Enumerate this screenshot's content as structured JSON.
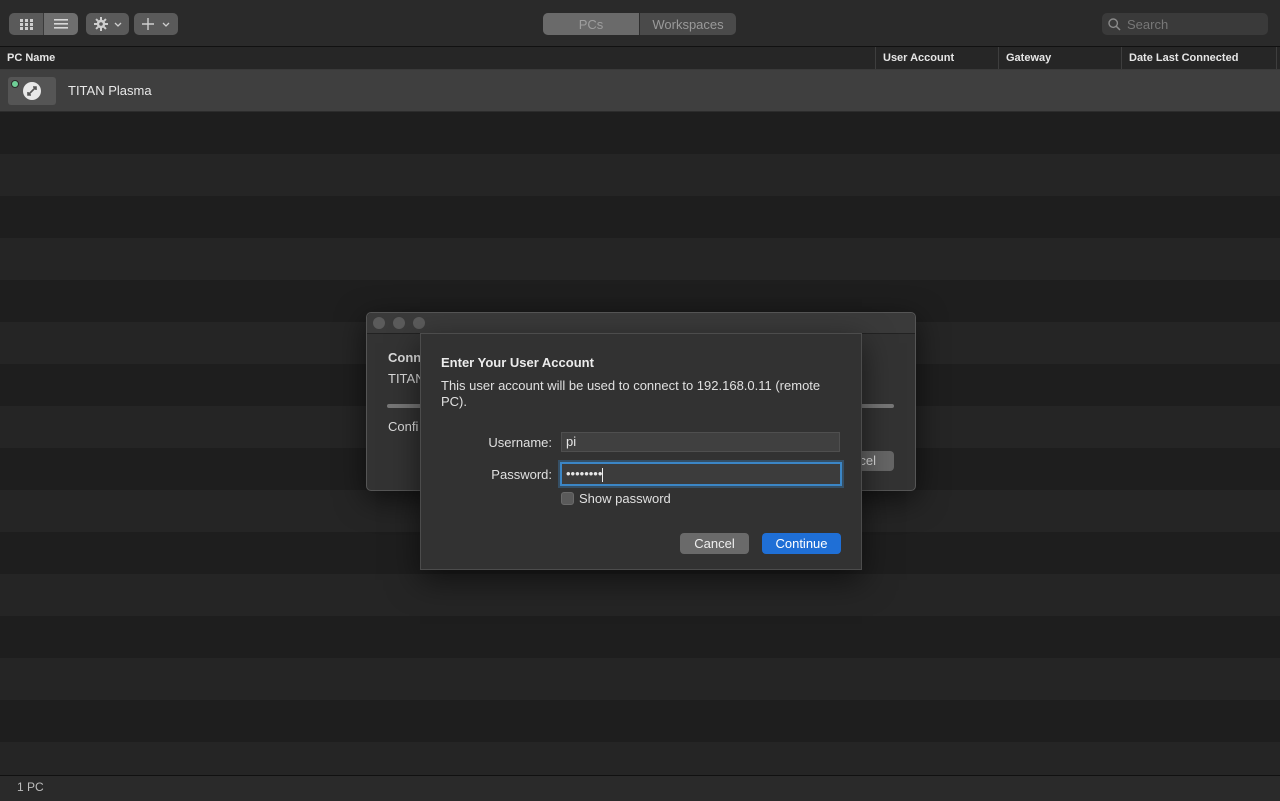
{
  "toolbar": {
    "tabs": [
      {
        "label": "PCs",
        "active": true
      },
      {
        "label": "Workspaces",
        "active": false
      }
    ],
    "search": {
      "placeholder": "Search"
    }
  },
  "table": {
    "columns": [
      "PC Name",
      "User Account",
      "Gateway",
      "Date Last Connected"
    ],
    "rows": [
      {
        "name": "TITAN Plasma",
        "user_account": "",
        "gateway": "",
        "date_last_connected": "",
        "online": true,
        "selected": true
      }
    ]
  },
  "status_bar": {
    "count_label": "1 PC"
  },
  "connecting_window": {
    "title_partial": "Conn",
    "pc_partial": "TITAN",
    "status_partial": "Confi",
    "cancel_partial": "cel"
  },
  "credentials_sheet": {
    "heading": "Enter Your User Account",
    "description": "This user account will be used to connect to 192.168.0.11 (remote PC).",
    "username_label": "Username:",
    "username_value": "pi",
    "password_label": "Password:",
    "password_masked": "••••••••",
    "show_password_label": "Show password",
    "show_password_checked": false,
    "cancel_label": "Cancel",
    "continue_label": "Continue"
  },
  "colors": {
    "accent": "#1f6fd6",
    "online_dot": "#6fcf97",
    "focus_ring": "#3b86c6"
  }
}
